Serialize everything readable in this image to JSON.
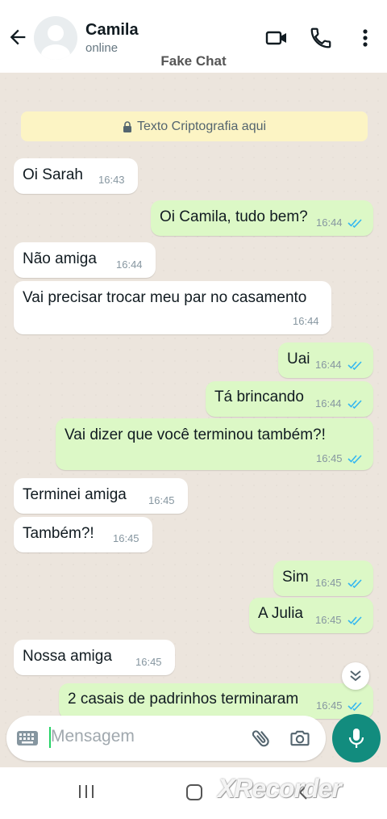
{
  "header": {
    "contact_name": "Camila",
    "status": "online",
    "overlay_label": "Fake Chat"
  },
  "encryption_banner": "Texto Criptografia aqui",
  "messages": [
    {
      "dir": "in",
      "text": "Oi Sarah",
      "time": "16:43"
    },
    {
      "dir": "out",
      "text": "Oi Camila, tudo bem?",
      "time": "16:44",
      "read": true
    },
    {
      "dir": "in",
      "text": "Não amiga",
      "time": "16:44"
    },
    {
      "dir": "in",
      "text": "Vai precisar trocar meu par no casamento",
      "time": "16:44"
    },
    {
      "dir": "out",
      "text": "Uai",
      "time": "16:44",
      "read": true
    },
    {
      "dir": "out",
      "text": "Tá brincando",
      "time": "16:44",
      "read": true
    },
    {
      "dir": "out",
      "text": "Vai dizer que você terminou também?!",
      "time": "16:45",
      "read": true
    },
    {
      "dir": "in",
      "text": "Terminei amiga",
      "time": "16:45"
    },
    {
      "dir": "in",
      "text": "Também?!",
      "time": "16:45"
    },
    {
      "dir": "out",
      "text": "Sim",
      "time": "16:45",
      "read": true
    },
    {
      "dir": "out",
      "text": "A Julia",
      "time": "16:45",
      "read": true
    },
    {
      "dir": "in",
      "text": "Nossa amiga",
      "time": "16:45"
    },
    {
      "dir": "out",
      "text": "2 casais de padrinhos terminaram",
      "time": "16:45",
      "read": true
    }
  ],
  "composer": {
    "placeholder": "Mensagem"
  },
  "watermark": "XRecorder",
  "colors": {
    "accent": "#128c7e",
    "outgoing_bubble": "#dcf8c6",
    "incoming_bubble": "#ffffff",
    "read_ticks": "#34b7f1",
    "chat_background": "#ece5dd"
  }
}
